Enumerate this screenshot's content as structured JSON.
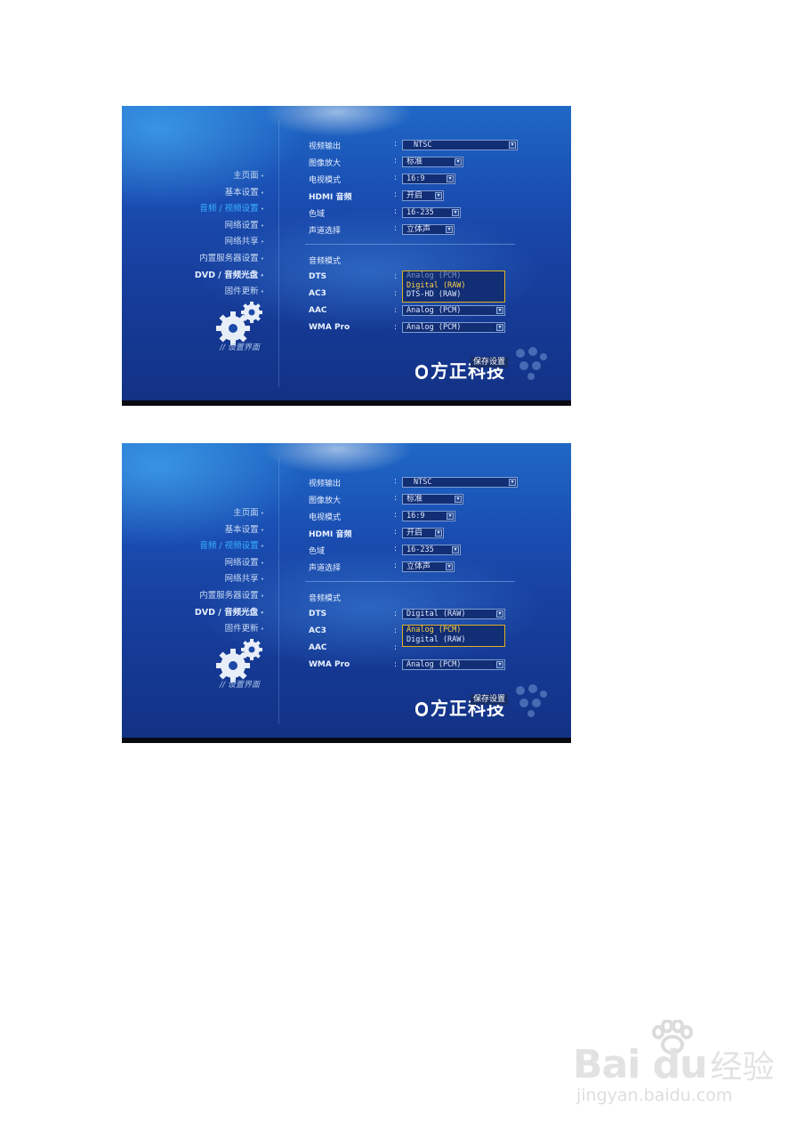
{
  "menu": [
    "主页面",
    "基本设置",
    "音频 / 视频设置",
    "网络设置",
    "网络共享",
    "内置服务器设置",
    "DVD / 音频光盘",
    "固件更新"
  ],
  "caption": "// 设置界面",
  "labels": {
    "video_output": "视频输出",
    "zoom": "图像放大",
    "tv_mode": "电视模式",
    "hdmi_audio": "HDMI 音频",
    "color_gamut": "色域",
    "channel": "声道选择",
    "audio_mode": "音频模式",
    "dts": "DTS",
    "ac3": "AC3",
    "aac": "AAC",
    "wma": "WMA Pro"
  },
  "colon": ":",
  "chevron": "▾",
  "values": {
    "video_output": "NTSC",
    "zoom": "标准",
    "tv_mode": "16:9",
    "hdmi_audio": "开启",
    "color_gamut": "16-235",
    "channel": "立体声",
    "analog_pcm": "Analog (PCM)",
    "digital_raw": "Digital (RAW)",
    "dts_hd_raw": "DTS-HD (RAW)"
  },
  "brand": {
    "logo": "方正科技",
    "save": "保存设置"
  },
  "screen1": {
    "dts_dropdown": [
      "Analog (PCM)",
      "Digital (RAW)",
      "DTS-HD (RAW)"
    ],
    "highlight_index": 1
  },
  "screen2": {
    "dts_value": "Digital (RAW)",
    "ac3_dropdown": [
      "Analog (PCM)",
      "Digital (RAW)"
    ],
    "highlight_index": 0
  },
  "watermark": {
    "brand": "Bai du",
    "exp": "经验",
    "url": "jingyan.baidu.com"
  }
}
